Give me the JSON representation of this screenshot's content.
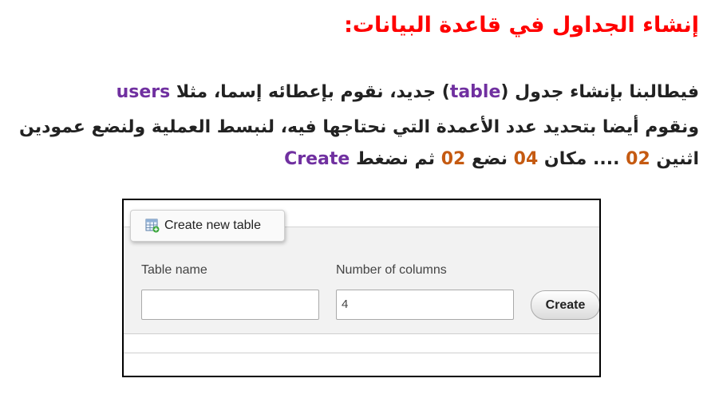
{
  "heading": "إنشاء الجداول في قاعدة البيانات:",
  "paragraph1": {
    "part1": "فيطالبنا بإنشاء جدول (",
    "term_table": "table",
    "part2": ") جديد، نقوم بإعطائه إسما، مثلا ",
    "term_users": "users"
  },
  "paragraph2": "ونقوم أيضا بتحديد عدد الأعمدة التي نحتاجها فيه، لنبسط العملية ولنضع عمودين",
  "paragraph3": {
    "part1": "اثنين ",
    "num_a": "02",
    "part2": " .... مكان ",
    "num_b": "04",
    "part3": " نضع ",
    "num_c": "02",
    "part4": " ثم نضغط ",
    "term_create": "Create"
  },
  "screenshot": {
    "legend_label": "Create new table",
    "legend_icon": "table-add-icon",
    "table_name_label": "Table name",
    "table_name_value": "",
    "columns_label": "Number of columns",
    "columns_value": "4",
    "create_button": "Create"
  },
  "colors": {
    "heading": "#ff0000",
    "purple_terms": "#7030a0",
    "orange_numbers": "#c55a11"
  }
}
